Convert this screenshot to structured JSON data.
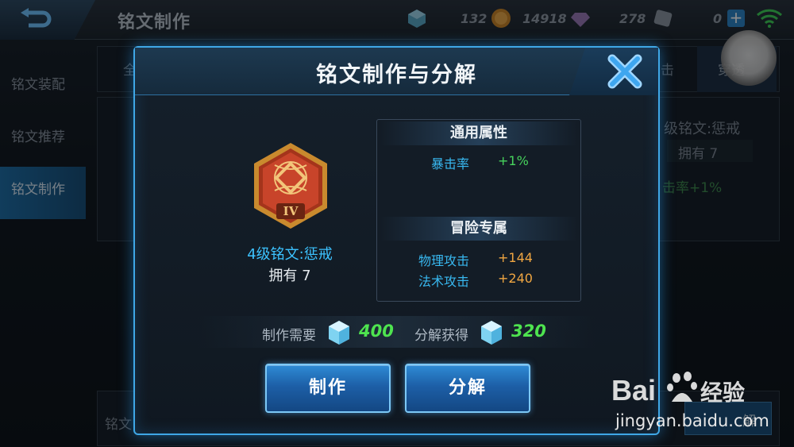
{
  "topbar": {
    "title": "铭文制作",
    "resources": [
      {
        "icon": "cube-gem-icon",
        "value": "132"
      },
      {
        "icon": "gold-coin-icon",
        "value": "14918"
      },
      {
        "icon": "diamond-icon",
        "value": "278"
      },
      {
        "icon": "voucher-icon",
        "value": "0"
      }
    ]
  },
  "sidebar": {
    "items": [
      {
        "label": "铭文装配"
      },
      {
        "label": "铭文推荐"
      },
      {
        "label": "铭文制作"
      }
    ]
  },
  "background": {
    "tab_left_partial": "全",
    "tab_right_partial": "击",
    "tab_right_label": "穿透",
    "right_panel_name": "级铭文:惩戒",
    "right_panel_owned": "拥有 7",
    "right_panel_stat": "击率+1%",
    "bottom_left_label": "铭文",
    "bottom_right_button": "解"
  },
  "dialog": {
    "title": "铭文制作与分解",
    "rune": {
      "name": "4级铭文:惩戒",
      "owned": "拥有 7",
      "tier": "IV"
    },
    "general_header": "通用属性",
    "general_attrs": [
      {
        "label": "暴击率",
        "value": "+1%"
      }
    ],
    "adventure_header": "冒险专属",
    "adventure_attrs": [
      {
        "label": "物理攻击",
        "value": "+144"
      },
      {
        "label": "法术攻击",
        "value": "+240"
      }
    ],
    "craft_cost_label": "制作需要",
    "craft_cost_value": "400",
    "decompose_gain_label": "分解获得",
    "decompose_gain_value": "320",
    "craft_button": "制作",
    "decompose_button": "分解"
  },
  "watermark": {
    "brand": "Baidu经验",
    "url": "jingyan.baidu.com"
  },
  "colors": {
    "accent_blue": "#3fa7e6",
    "rune_name": "#3cc2ff",
    "positive_green": "#47d45d",
    "attack_orange": "#f0a642"
  }
}
